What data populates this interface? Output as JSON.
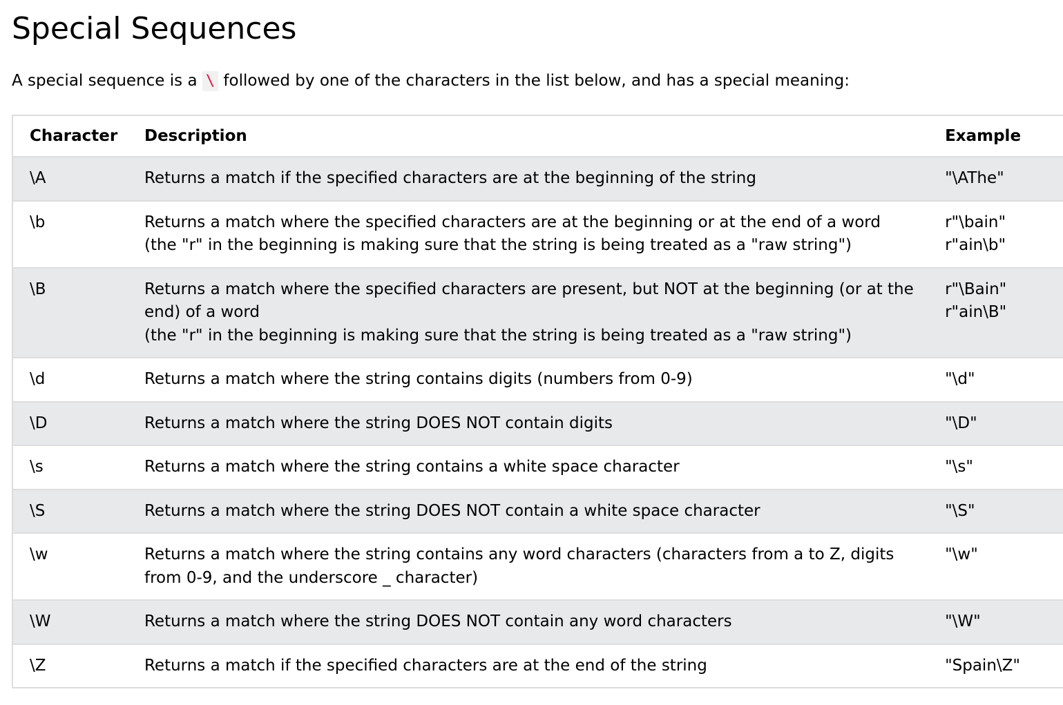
{
  "heading": "Special Sequences",
  "intro": {
    "before": "A special sequence is a ",
    "code": "\\",
    "after": " followed by one of the characters in the list below, and has a special meaning:"
  },
  "table": {
    "headers": {
      "character": "Character",
      "description": "Description",
      "example": "Example"
    },
    "rows": [
      {
        "character": "\\A",
        "description": [
          "Returns a match if the specified characters are at the beginning of the string"
        ],
        "example": [
          "\"\\AThe\""
        ]
      },
      {
        "character": "\\b",
        "description": [
          "Returns a match where the specified characters are at the beginning or at the end of a word",
          "(the \"r\" in the beginning is making sure that the string is being treated as a \"raw string\")"
        ],
        "example": [
          "r\"\\bain\"",
          "r\"ain\\b\""
        ]
      },
      {
        "character": "\\B",
        "description": [
          "Returns a match where the specified characters are present, but NOT at the beginning (or at the end) of a word",
          "(the \"r\" in the beginning is making sure that the string is being treated as a \"raw string\")"
        ],
        "example": [
          "r\"\\Bain\"",
          "r\"ain\\B\""
        ]
      },
      {
        "character": "\\d",
        "description": [
          "Returns a match where the string contains digits (numbers from 0-9)"
        ],
        "example": [
          "\"\\d\""
        ]
      },
      {
        "character": "\\D",
        "description": [
          "Returns a match where the string DOES NOT contain digits"
        ],
        "example": [
          "\"\\D\""
        ]
      },
      {
        "character": "\\s",
        "description": [
          "Returns a match where the string contains a white space character"
        ],
        "example": [
          "\"\\s\""
        ]
      },
      {
        "character": "\\S",
        "description": [
          "Returns a match where the string DOES NOT contain a white space character"
        ],
        "example": [
          "\"\\S\""
        ]
      },
      {
        "character": "\\w",
        "description": [
          "Returns a match where the string contains any word characters (characters from a to Z, digits from 0-9, and the underscore _ character)"
        ],
        "example": [
          "\"\\w\""
        ]
      },
      {
        "character": "\\W",
        "description": [
          "Returns a match where the string DOES NOT contain any word characters"
        ],
        "example": [
          "\"\\W\""
        ]
      },
      {
        "character": "\\Z",
        "description": [
          "Returns a match if the specified characters are at the end of the string"
        ],
        "example": [
          "\"Spain\\Z\""
        ]
      }
    ]
  },
  "colors": {
    "code_text": "#dc143c",
    "alt_row_bg": "#e7e9eb",
    "border": "#dddddd"
  }
}
